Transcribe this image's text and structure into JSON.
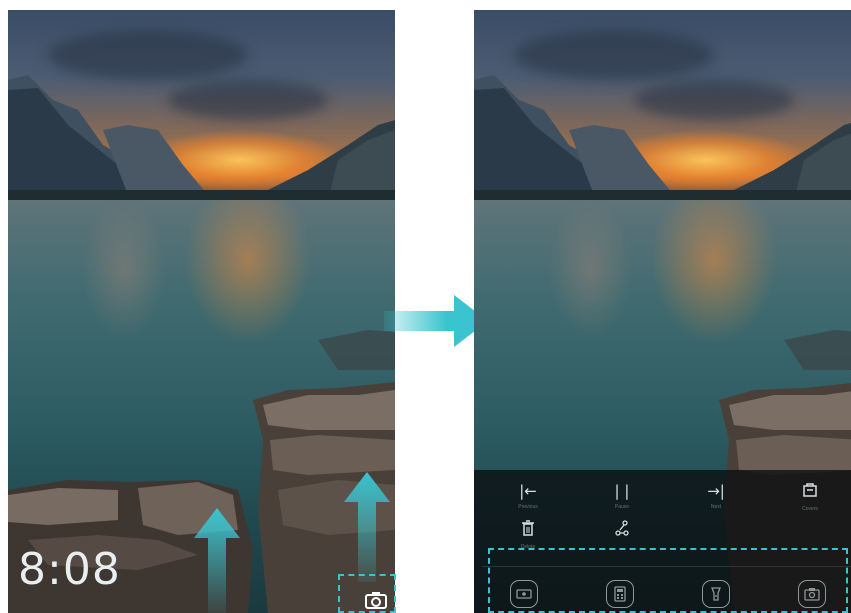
{
  "left_screen": {
    "clock": "8:08",
    "camera_icon": "camera-icon",
    "swipe_hint_icon": "arrow-up-icon"
  },
  "right_screen": {
    "music_controls": [
      {
        "icon": "previous-icon",
        "glyph": "|←",
        "label": "Previous"
      },
      {
        "icon": "pause-icon",
        "glyph": "| |",
        "label": "Pause"
      },
      {
        "icon": "next-icon",
        "glyph": "→|",
        "label": "Next"
      },
      {
        "icon": "covers-icon",
        "glyph": "",
        "label": "Covers"
      }
    ],
    "extra_controls": [
      {
        "icon": "delete-icon",
        "label": "Delete"
      },
      {
        "icon": "share-icon",
        "label": ""
      }
    ],
    "shortcuts": [
      {
        "icon": "screen-recorder-icon"
      },
      {
        "icon": "calculator-icon"
      },
      {
        "icon": "flashlight-icon"
      },
      {
        "icon": "camera-icon"
      }
    ]
  },
  "colors": {
    "accent": "#3ac4cf",
    "panel_bg": "#0a0e10"
  }
}
